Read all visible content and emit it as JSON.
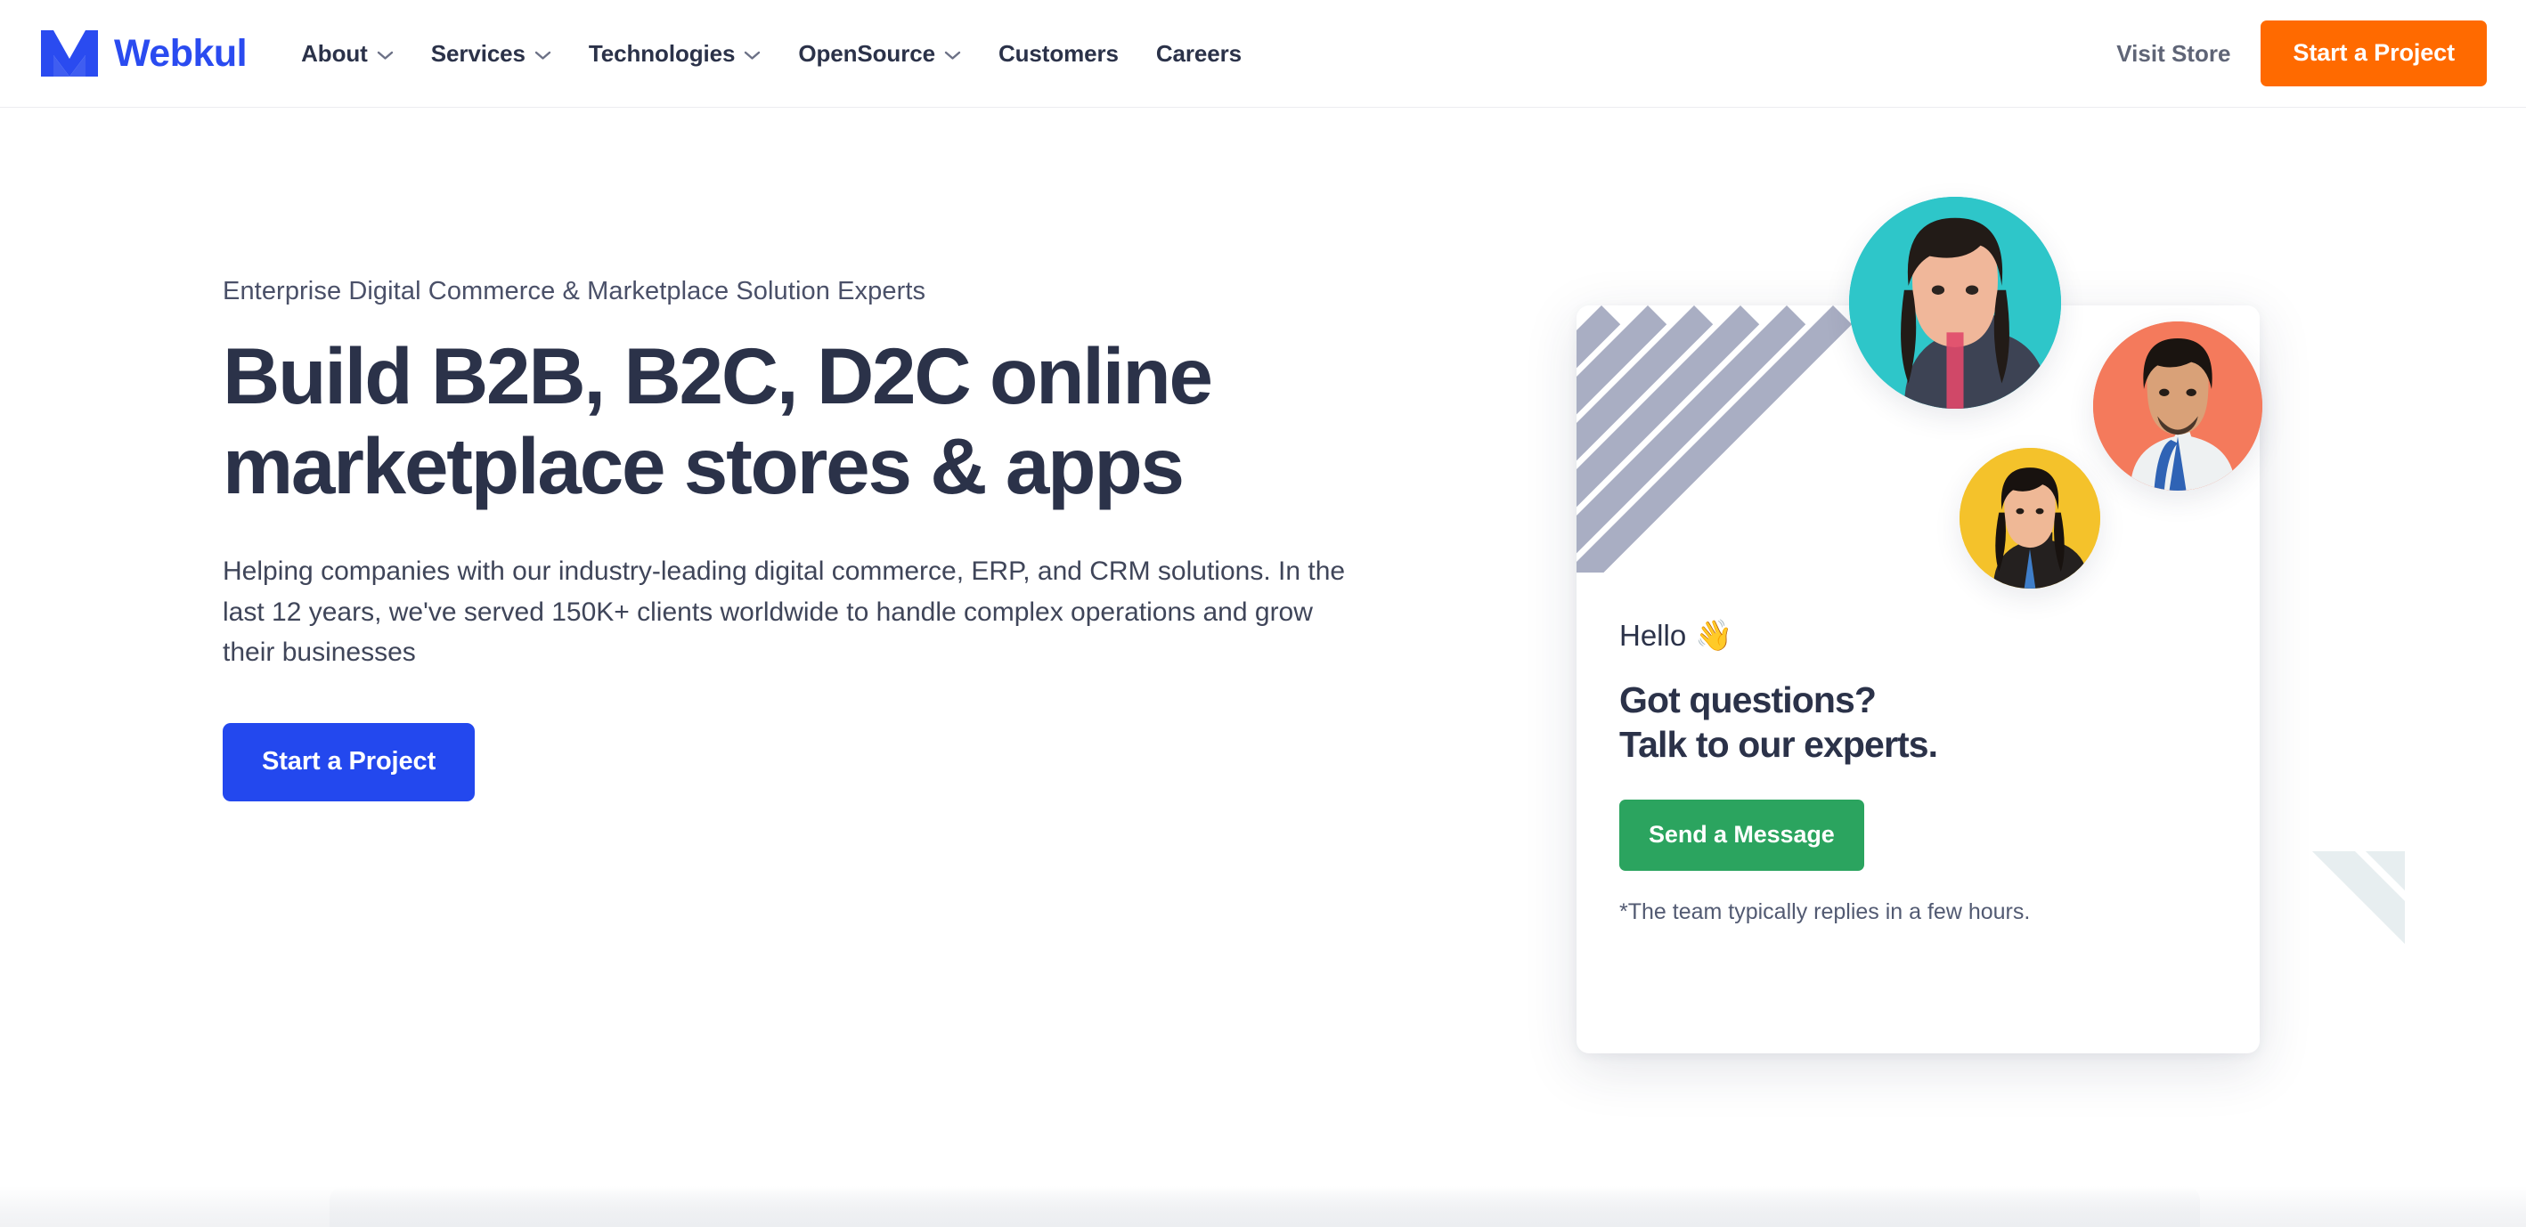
{
  "header": {
    "brand": {
      "name": "Webkul",
      "mark_icon": "webkul-logo-icon",
      "color": "#2a4bf0"
    },
    "nav": [
      {
        "label": "About",
        "has_dropdown": true,
        "icon": "chevron-down-icon"
      },
      {
        "label": "Services",
        "has_dropdown": true,
        "icon": "chevron-down-icon"
      },
      {
        "label": "Technologies",
        "has_dropdown": true,
        "icon": "chevron-down-icon"
      },
      {
        "label": "OpenSource",
        "has_dropdown": true,
        "icon": "chevron-down-icon"
      },
      {
        "label": "Customers",
        "has_dropdown": false,
        "icon": ""
      },
      {
        "label": "Careers",
        "has_dropdown": false,
        "icon": ""
      }
    ],
    "visit_store_label": "Visit Store",
    "cta_label": "Start a Project",
    "cta_color": "#ff6a00"
  },
  "hero": {
    "eyebrow": "Enterprise Digital Commerce & Marketplace Solution Experts",
    "headline": "Build B2B, B2C, D2C online marketplace stores & apps",
    "subcopy": "Helping companies with our industry-leading digital commerce, ERP, and CRM solutions. In the last 12 years, we've served 150K+ clients worldwide to handle complex operations and grow their businesses",
    "cta_label": "Start a Project",
    "cta_color": "#2348ee",
    "headline_color": "#2b3249"
  },
  "contact_card": {
    "greeting": "Hello",
    "greeting_emoji": "👋",
    "title_line1": "Got questions?",
    "title_line2": "Talk to our experts.",
    "cta_label": "Send a Message",
    "cta_color": "#2ba45f",
    "note": "*The team typically replies in a few hours.",
    "stripe_color": "#a9aec3",
    "avatars": [
      {
        "name": "team-member-avatar-1",
        "bg": "#2ec6c9"
      },
      {
        "name": "team-member-avatar-2",
        "bg": "#f47a5c"
      },
      {
        "name": "team-member-avatar-3",
        "bg": "#f4c22b"
      }
    ]
  }
}
